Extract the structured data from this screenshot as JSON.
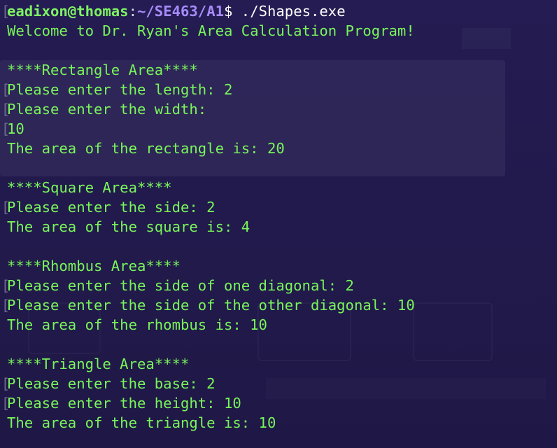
{
  "colors": {
    "background": "#231b4f",
    "output_text": "#79f55a",
    "prompt_user": "#7ff263",
    "prompt_path": "#a78bfa",
    "command_text": "#ffffff",
    "margin_mark": "#6e6a90"
  },
  "prompt": {
    "userhost": "eadixon@thomas",
    "colon": ":",
    "path": "~/SE463/A1",
    "symbol": "$",
    "command": " ./Shapes.exe"
  },
  "lines": [
    "Welcome to Dr. Ryan's Area Calculation Program!",
    "",
    "****Rectangle Area****",
    "Please enter the length: 2",
    "Please enter the width:",
    "10",
    "The area of the rectangle is: 20",
    "",
    "****Square Area****",
    "Please enter the side: 2",
    "The area of the square is: 4",
    "",
    "****Rhombus Area****",
    "Please enter the side of one diagonal: 2",
    "Please enter the side of the other diagonal: 10",
    "The area of the rhombus is: 10",
    "",
    "****Triangle Area****",
    "Please enter the base: 2",
    "Please enter the height: 10",
    "The area of the triangle is: 10"
  ],
  "margin_mark": "["
}
